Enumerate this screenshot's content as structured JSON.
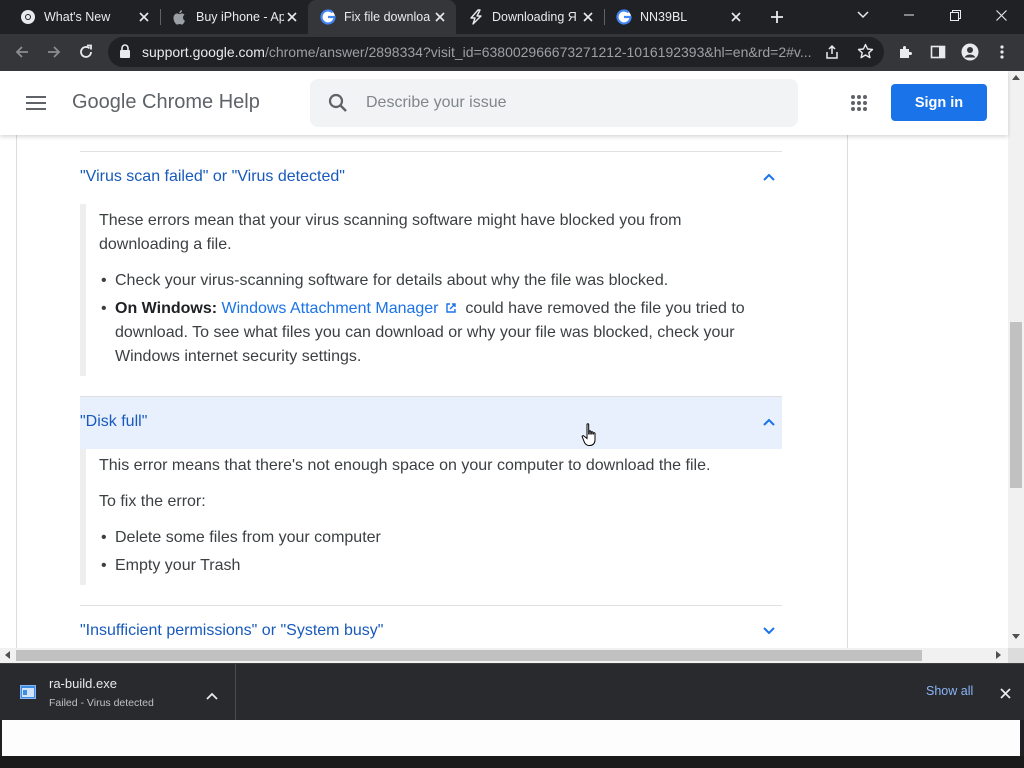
{
  "tabs": [
    {
      "title": "What's New",
      "icon": "chrome-icon"
    },
    {
      "title": "Buy iPhone - Ap",
      "icon": "apple-icon"
    },
    {
      "title": "Fix file downloa",
      "icon": "google-icon",
      "active": true
    },
    {
      "title": "Downloading Я",
      "icon": "lightning-icon"
    },
    {
      "title": "NN39BL",
      "icon": "google-icon"
    }
  ],
  "url": {
    "host": "support.google.com",
    "path": "/chrome/answer/2898334?visit_id=638002966673271212-1016192393&hl=en&rd=2#v..."
  },
  "header": {
    "title": "Google Chrome Help",
    "search_placeholder": "Describe your issue",
    "signin_label": "Sign in"
  },
  "sections": {
    "virus": {
      "title": "\"Virus scan failed\" or \"Virus detected\"",
      "p1": "These errors mean that your virus scanning software might have blocked you from downloading a file.",
      "bullet1": "Check your virus-scanning software for details about why the file was blocked.",
      "bullet2_bold": "On Windows:",
      "bullet2_link": "Windows Attachment Manager",
      "bullet2_rest": "could have removed the file you tried to download. To see what files you can download or why your file was blocked, check your Windows internet security settings."
    },
    "disk": {
      "title": "\"Disk full\"",
      "p1": "This error means that there's not enough space on your computer to download the file.",
      "p2": "To fix the error:",
      "bullet1": "Delete some files from your computer",
      "bullet2": "Empty your Trash"
    },
    "perm": {
      "title": "\"Insufficient permissions\" or \"System busy\""
    }
  },
  "download": {
    "filename": "ra-build.exe",
    "status": "Failed - Virus detected",
    "show_all": "Show all"
  },
  "colors": {
    "accent": "#1a73e8",
    "link": "#185abc",
    "hover_bg": "#e8f0fe"
  }
}
